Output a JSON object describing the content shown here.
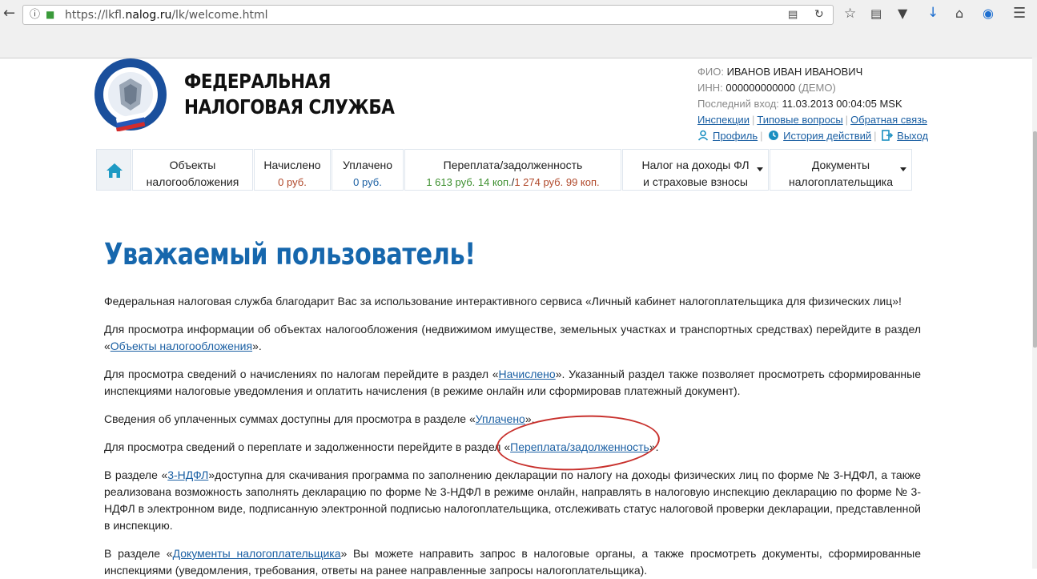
{
  "browser": {
    "url_prefix": "https://lkfl.",
    "url_host": "nalog.ru",
    "url_path": "/lk/welcome.html"
  },
  "header": {
    "org_line1": "ФЕДЕРАЛЬНАЯ",
    "org_line2": "НАЛОГОВАЯ СЛУЖБА",
    "fio_label": "ФИО:",
    "fio_value": "ИВАНОВ ИВАН ИВАНОВИЧ",
    "inn_label": "ИНН:",
    "inn_value": "000000000000",
    "inn_note": "(ДЕМО)",
    "last_login_label": "Последний вход:",
    "last_login_value": "11.03.2013 00:04:05 MSK",
    "links": [
      "Инспекции",
      "Типовые вопросы",
      "Обратная связь"
    ],
    "profile": "Профиль",
    "history": "История действий",
    "logout": "Выход"
  },
  "nav": {
    "objects_line1": "Объекты",
    "objects_line2": "налогообложения",
    "accrued": "Начислено",
    "accrued_sum": "0 руб.",
    "paid": "Уплачено",
    "paid_sum": "0 руб.",
    "balance": "Переплата/задолженность",
    "balance_over": "1 613 руб. 14 коп.",
    "balance_slash": "/",
    "balance_debt": "1 274 руб. 99 коп.",
    "ndfl_line1": "Налог на доходы ФЛ",
    "ndfl_line2": "и страховые взносы",
    "docs_line1": "Документы",
    "docs_line2": "налогоплательщика"
  },
  "colors": {
    "accent": "#1667ad",
    "overpay": "#3c8f2e",
    "debt": "#b0482a",
    "highlight": "#c8312d"
  },
  "content": {
    "title": "Уважаемый пользователь!",
    "p1": "Федеральная налоговая служба благодарит Вас за использование интерактивного сервиса «Личный кабинет налогоплательщика для физических лиц»!",
    "p2_a": "Для просмотра информации об объектах налогообложения (недвижимом имуществе, земельных участках и транспортных средствах) перейдите в раздел «",
    "p2_link": "Объекты налогообложения",
    "p2_b": "».",
    "p3_a": "Для просмотра сведений о начислениях по налогам перейдите в раздел «",
    "p3_link": "Начислено",
    "p3_b": "». Указанный раздел также позволяет просмотреть сформированные инспекциями налоговые уведомления и оплатить начисления (в режиме онлайн или сформировав платежный документ).",
    "p4_a": "Сведения об уплаченных суммах доступны для просмотра в разделе «",
    "p4_link": "Уплачено",
    "p4_b": "».",
    "p5_a": "Для просмотра сведений о переплате и задолженности перейдите в раздел «",
    "p5_link": "Переплата/задолженность",
    "p5_b": "».",
    "p6_a": "В разделе «",
    "p6_link": "3-НДФЛ",
    "p6_b": "»доступна для скачивания программа по заполнению декларации по налогу на доходы физических лиц по форме № 3-НДФЛ, а также реализована возможность заполнять декларацию по форме № 3-НДФЛ в режиме онлайн, направлять в налоговую инспекцию декларацию по форме № 3-НДФЛ в электронном виде, подписанную электронной подписью налогоплательщика, отслеживать статус налоговой проверки декларации, представленной в инспекцию.",
    "p7_a": "В разделе «",
    "p7_link": "Документы налогоплательщика",
    "p7_b": "» Вы можете направить запрос в налоговые органы, а также просмотреть документы, сформированные инспекциями (уведомления, требования, ответы на ранее направленные запросы налогоплательщика)."
  }
}
